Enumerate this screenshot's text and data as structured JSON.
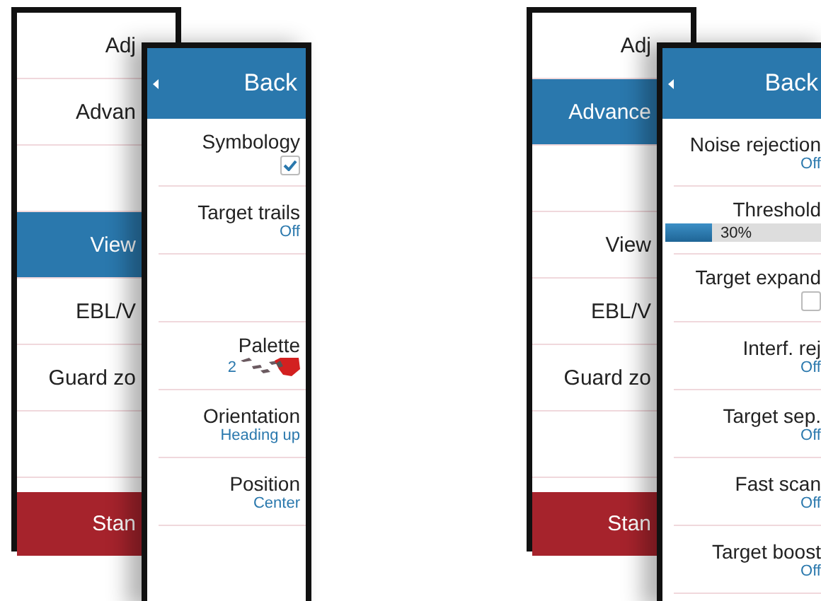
{
  "panels": [
    {
      "back_menu": {
        "items": [
          {
            "kind": "normal",
            "label": "Adj",
            "selected": false
          },
          {
            "kind": "normal",
            "label": "Advan",
            "selected": false
          },
          {
            "kind": "blank",
            "selected": false
          },
          {
            "kind": "normal",
            "label": "View",
            "selected": true
          },
          {
            "kind": "normal",
            "label": "EBL/V",
            "selected": false
          },
          {
            "kind": "normal",
            "label": "Guard zo",
            "selected": false
          },
          {
            "kind": "blank",
            "selected": false
          },
          {
            "kind": "alert",
            "label": "Stan",
            "selected": false
          }
        ]
      },
      "front_menu": {
        "header": "Back",
        "items": [
          {
            "kind": "checkbox",
            "label": "Symbology",
            "checked": true
          },
          {
            "kind": "value",
            "label": "Target trails",
            "value": "Off"
          },
          {
            "kind": "blank"
          },
          {
            "kind": "palette",
            "label": "Palette",
            "value": "2"
          },
          {
            "kind": "value",
            "label": "Orientation",
            "value": "Heading up"
          },
          {
            "kind": "value",
            "label": "Position",
            "value": "Center"
          }
        ]
      }
    },
    {
      "back_menu": {
        "items": [
          {
            "kind": "normal",
            "label": "Adj",
            "selected": false
          },
          {
            "kind": "normal",
            "label": "Advance",
            "selected": true
          },
          {
            "kind": "blank",
            "selected": false
          },
          {
            "kind": "normal",
            "label": "View",
            "selected": false
          },
          {
            "kind": "normal",
            "label": "EBL/V",
            "selected": false
          },
          {
            "kind": "normal",
            "label": "Guard zo",
            "selected": false
          },
          {
            "kind": "blank",
            "selected": false
          },
          {
            "kind": "alert",
            "label": "Stan",
            "selected": false
          }
        ]
      },
      "front_menu": {
        "header": "Back",
        "items": [
          {
            "kind": "value",
            "label": "Noise rejection",
            "value": "Off"
          },
          {
            "kind": "slider",
            "label": "Threshold",
            "level": 0.3,
            "reading": "30%"
          },
          {
            "kind": "checkbox",
            "label": "Target expand",
            "checked": false
          },
          {
            "kind": "value",
            "label": "Interf. rej",
            "value": "Off"
          },
          {
            "kind": "value",
            "label": "Target sep.",
            "value": "Off"
          },
          {
            "kind": "value",
            "label": "Fast scan",
            "value": "Off"
          },
          {
            "kind": "value",
            "label": "Target boost",
            "value": "Off"
          }
        ]
      }
    }
  ]
}
